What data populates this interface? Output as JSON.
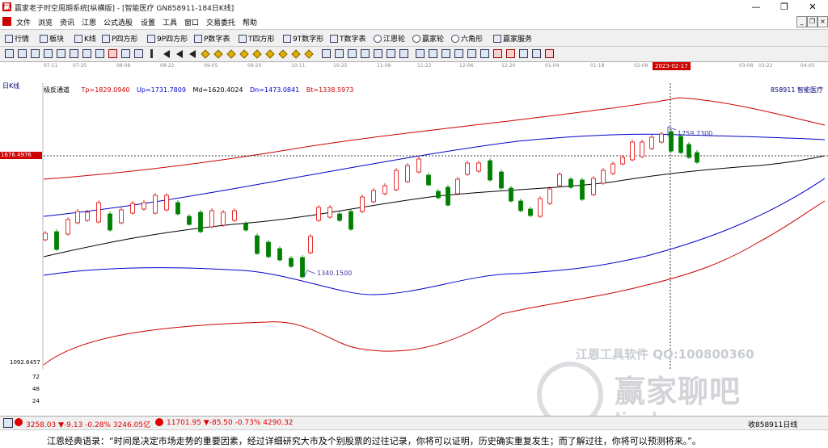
{
  "window": {
    "title": "赢家老子时空周期系统[纵横版] - [智能医疗  GN858911-184日K线]",
    "min_label": "—",
    "max_label": "❐",
    "close_label": "✕"
  },
  "menu": [
    "文件",
    "浏览",
    "资讯",
    "江恩",
    "公式选股",
    "设置",
    "工具",
    "窗口",
    "交易委托",
    "帮助"
  ],
  "toolbar1": [
    "行情",
    "板块",
    "K线",
    "P四方形",
    "9P四方形",
    "P数字表",
    "T四方形",
    "9T数字形",
    "T数字表",
    "江恩轮",
    "赢家轮",
    "六角形",
    "赢家服务"
  ],
  "dates": [
    "07-11",
    "07-25",
    "08-08",
    "08-22",
    "09-05",
    "09-20",
    "10-11",
    "10-25",
    "11-08",
    "11-22",
    "12-06",
    "12-20",
    "01-04",
    "01-18",
    "02-08",
    "03-08",
    "03-22",
    "04-05"
  ],
  "selected_date": "2023-02-17",
  "period_label": "日K线",
  "indicator": {
    "name": "极反通道",
    "tp": "Tp=1829.0940",
    "up": "Up=1731.7809",
    "md": "Md=1620.4024",
    "dn": "Dn=1473.0841",
    "bt": "Bt=1338.5973"
  },
  "stock": {
    "code": "858911",
    "name": "智能医疗"
  },
  "price_axis": {
    "current": "1676.4976",
    "low": "1092.6457"
  },
  "annotations": {
    "high": "1759.7300",
    "low": "1340.1500"
  },
  "volume_ticks": [
    "72",
    "48",
    "24"
  ],
  "watermark": {
    "line1": "江恩工具软件  QQ:100800360",
    "line2": "赢家聊吧",
    "line3": "Jiaoba.y..."
  },
  "status": {
    "sh": "3258.03 ▼-9.13 -0.28% 3246.05亿",
    "sz": "11701.95 ▼-85.50 -0.73% 4290.32",
    "right": "收858911日线"
  },
  "marquee": "江恩经典语录：“时间是决定市场走势的重要因素，经过详细研究大市及个别股票的过往记录，你将可以证明，历史确实重复发生；而了解过往，你将可以预测将来。”。",
  "colors": {
    "up": "#dd0000",
    "down": "#008000",
    "outer_band": "#cc0000",
    "inner_band": "#0000cc",
    "mid_line": "#000000"
  }
}
